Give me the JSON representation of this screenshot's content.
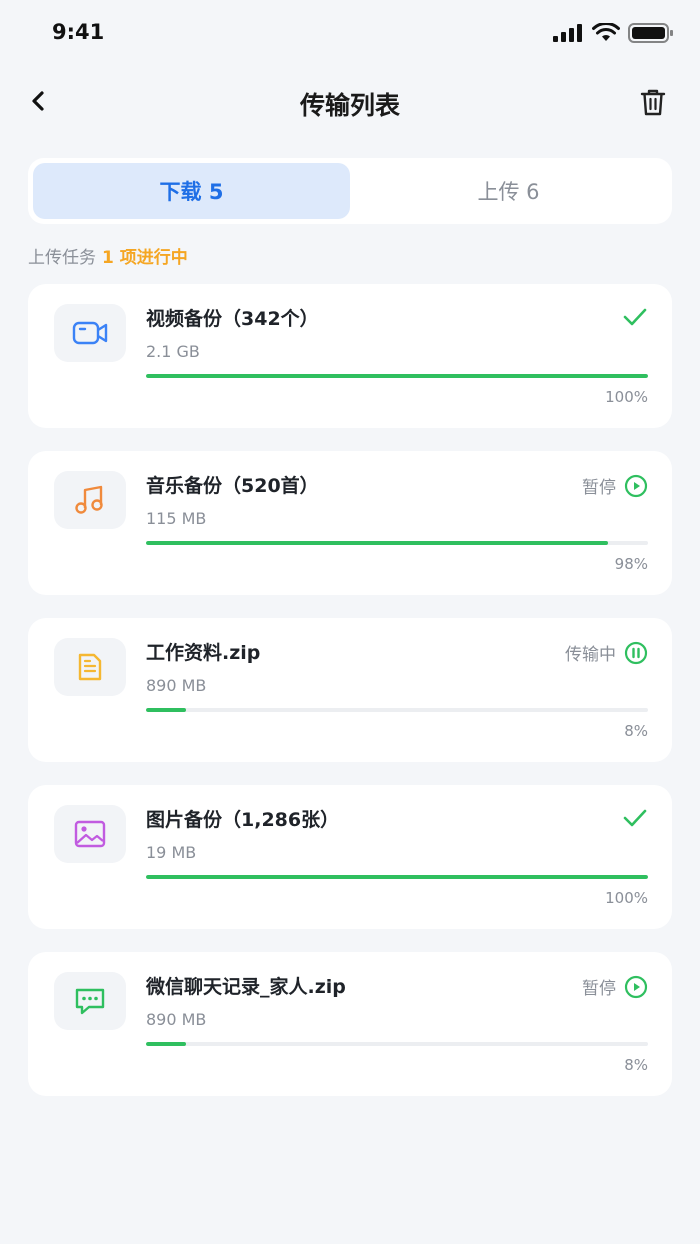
{
  "status_bar": {
    "time": "9:41"
  },
  "nav": {
    "title": "传输列表"
  },
  "tabs": [
    {
      "label": "下载 5",
      "active": true
    },
    {
      "label": "上传 6",
      "active": false
    }
  ],
  "summary": {
    "prefix": "上传任务",
    "highlight": "1 项进行中"
  },
  "items": [
    {
      "name": "视频备份（342个）",
      "size": "2.1 GB",
      "status_text": "",
      "status_icon": "check-icon",
      "progress": 100,
      "percent_label": "100%",
      "icon": "video-icon",
      "icon_color": "#3b82f6"
    },
    {
      "name": "音乐备份（520首）",
      "size": "115 MB",
      "status_text": "暂停",
      "status_icon": "play-circle-icon",
      "progress": 92,
      "percent_label": "98%",
      "icon": "music-icon",
      "icon_color": "#f08a3c"
    },
    {
      "name": "工作资料.zip",
      "size": "890 MB",
      "status_text": "传输中",
      "status_icon": "pause-circle-icon",
      "progress": 8,
      "percent_label": "8%",
      "icon": "document-icon",
      "icon_color": "#f5b731"
    },
    {
      "name": "图片备份（1,286张）",
      "size": "19 MB",
      "status_text": "",
      "status_icon": "check-icon",
      "progress": 100,
      "percent_label": "100%",
      "icon": "image-icon",
      "icon_color": "#c15be0"
    },
    {
      "name": "微信聊天记录_家人.zip",
      "size": "890 MB",
      "status_text": "暂停",
      "status_icon": "play-circle-icon",
      "progress": 8,
      "percent_label": "8%",
      "icon": "chat-icon",
      "icon_color": "#2fbf5f"
    }
  ],
  "colors": {
    "accent": "#1f6fe6",
    "success": "#2fbf5f",
    "highlight": "#f5a623"
  }
}
